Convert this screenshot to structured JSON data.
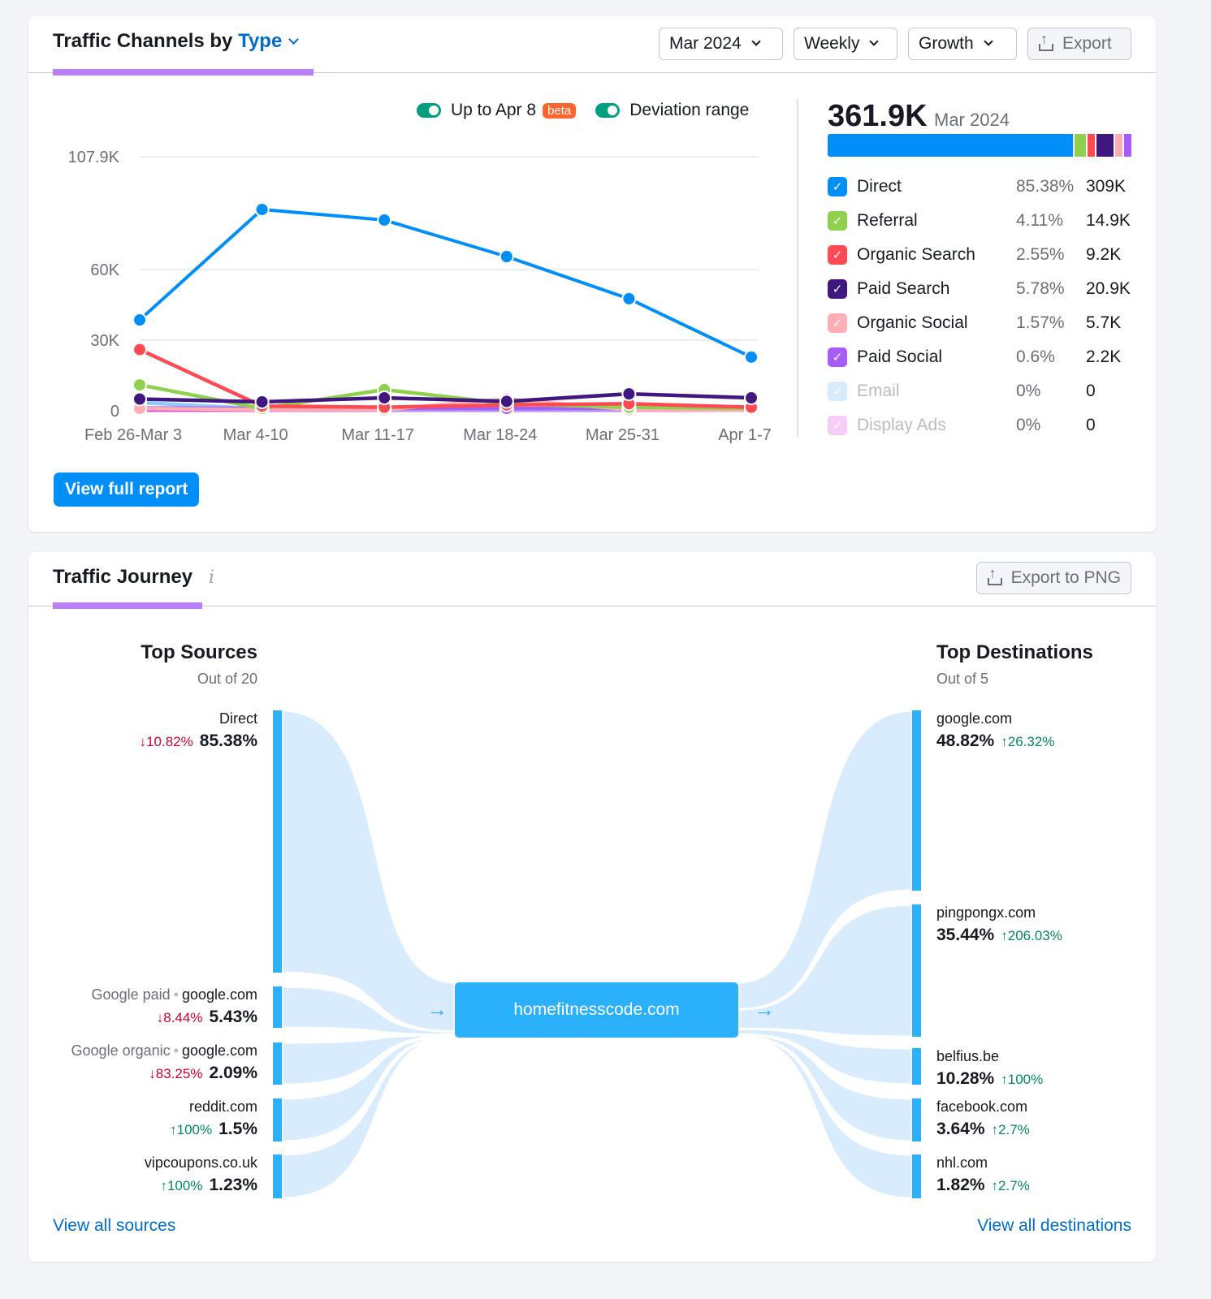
{
  "channels_card": {
    "title_prefix": "Traffic Channels by",
    "title_accent": "Type",
    "controls": {
      "period": "Mar 2024",
      "granularity": "Weekly",
      "metric": "Growth",
      "export_label": "Export"
    },
    "toggles": [
      {
        "label": "Up to Apr 8",
        "badge": "beta",
        "on": true
      },
      {
        "label": "Deviation range",
        "on": true
      }
    ],
    "summary": {
      "total": "361.9K",
      "period": "Mar 2024"
    },
    "channels": [
      {
        "name": "Direct",
        "pct": "85.38%",
        "value": "309K",
        "share": 85.38,
        "color": "#008ff8",
        "enabled": true
      },
      {
        "name": "Referral",
        "pct": "4.11%",
        "value": "14.9K",
        "share": 4.11,
        "color": "#8fd14f",
        "enabled": true
      },
      {
        "name": "Organic Search",
        "pct": "2.55%",
        "value": "9.2K",
        "share": 2.55,
        "color": "#ff4953",
        "enabled": true
      },
      {
        "name": "Paid Search",
        "pct": "5.78%",
        "value": "20.9K",
        "share": 5.78,
        "color": "#3f177f",
        "enabled": true
      },
      {
        "name": "Organic Social",
        "pct": "1.57%",
        "value": "5.7K",
        "share": 1.57,
        "color": "#ffaeb5",
        "enabled": true
      },
      {
        "name": "Paid Social",
        "pct": "0.6%",
        "value": "2.2K",
        "share": 0.6,
        "color": "#a75bf7",
        "enabled": true
      },
      {
        "name": "Email",
        "pct": "0%",
        "value": "0",
        "share": 0,
        "color": "#d6ecfd",
        "enabled": false
      },
      {
        "name": "Display Ads",
        "pct": "0%",
        "value": "0",
        "share": 0,
        "color": "#f6cdf6",
        "enabled": false
      }
    ],
    "view_full_report": "View full report"
  },
  "chart_data": {
    "type": "line",
    "title": "",
    "xlabel": "",
    "ylabel": "",
    "ylim": [
      0,
      107.9
    ],
    "y_ticks": [
      {
        "value": 0,
        "label": "0"
      },
      {
        "value": 30,
        "label": "30K"
      },
      {
        "value": 60,
        "label": "60K"
      },
      {
        "value": 107.9,
        "label": "107.9K"
      }
    ],
    "x": [
      "Feb 26-Mar 3",
      "Mar 4-10",
      "Mar 11-17",
      "Mar 18-24",
      "Mar 25-31",
      "Apr 1-7"
    ],
    "grid": true,
    "series": [
      {
        "name": "Display Ads",
        "color": "#e04fdc",
        "values": [
          0.3,
          0.3,
          0.3,
          0.3,
          0.3,
          0.3
        ]
      },
      {
        "name": "Email",
        "color": "#8ecbff",
        "values": [
          3.5,
          0.8,
          0.6,
          0.6,
          0.6,
          0.6
        ]
      },
      {
        "name": "Paid Social",
        "color": "#a75bf7",
        "values": [
          1.2,
          1.0,
          1.0,
          1.0,
          1.0,
          1.0
        ]
      },
      {
        "name": "Organic Social",
        "color": "#ffaeb5",
        "values": [
          1.0,
          0.5,
          0.5,
          5.0,
          0.5,
          0.3
        ]
      },
      {
        "name": "Referral",
        "color": "#8fd14f",
        "values": [
          11.0,
          1.0,
          9.0,
          3.0,
          1.5,
          1.0
        ]
      },
      {
        "name": "Organic Search",
        "color": "#ff4953",
        "values": [
          26.0,
          2.0,
          1.5,
          2.5,
          3.0,
          1.5
        ]
      },
      {
        "name": "Paid Search",
        "color": "#3f177f",
        "values": [
          5.0,
          3.8,
          5.5,
          4.0,
          7.2,
          5.5
        ]
      },
      {
        "name": "Direct",
        "color": "#008ff8",
        "values": [
          38.6,
          85.5,
          81.0,
          65.5,
          47.6,
          22.8
        ]
      }
    ]
  },
  "journey_card": {
    "title": "Traffic Journey",
    "info_icon": "i",
    "export_label": "Export to PNG",
    "center_site": "homefitnesscode.com",
    "sources": {
      "heading": "Top Sources",
      "subheading": "Out of 20",
      "items": [
        {
          "prefix": "",
          "label": "Direct",
          "change": "10.82%",
          "direction": "down",
          "share": "85.38%",
          "value": 85.38
        },
        {
          "prefix": "Google paid",
          "label": "google.com",
          "change": "8.44%",
          "direction": "down",
          "share": "5.43%",
          "value": 5.43
        },
        {
          "prefix": "Google organic",
          "label": "google.com",
          "change": "83.25%",
          "direction": "down",
          "share": "2.09%",
          "value": 2.09
        },
        {
          "prefix": "",
          "label": "reddit.com",
          "change": "100%",
          "direction": "up",
          "share": "1.5%",
          "value": 1.5
        },
        {
          "prefix": "",
          "label": "vipcoupons.co.uk",
          "change": "100%",
          "direction": "up",
          "share": "1.23%",
          "value": 1.23
        }
      ],
      "view_all": "View all sources"
    },
    "destinations": {
      "heading": "Top Destinations",
      "subheading": "Out of 5",
      "items": [
        {
          "label": "google.com",
          "change": "26.32%",
          "direction": "up",
          "share": "48.82%",
          "value": 48.82
        },
        {
          "label": "pingpongx.com",
          "change": "206.03%",
          "direction": "up",
          "share": "35.44%",
          "value": 35.44
        },
        {
          "label": "belfius.be",
          "change": "100%",
          "direction": "up",
          "share": "10.28%",
          "value": 10.28
        },
        {
          "label": "facebook.com",
          "change": "2.7%",
          "direction": "up",
          "share": "3.64%",
          "value": 3.64
        },
        {
          "label": "nhl.com",
          "change": "2.7%",
          "direction": "up",
          "share": "1.82%",
          "value": 1.82
        }
      ],
      "view_all": "View all destinations"
    }
  }
}
